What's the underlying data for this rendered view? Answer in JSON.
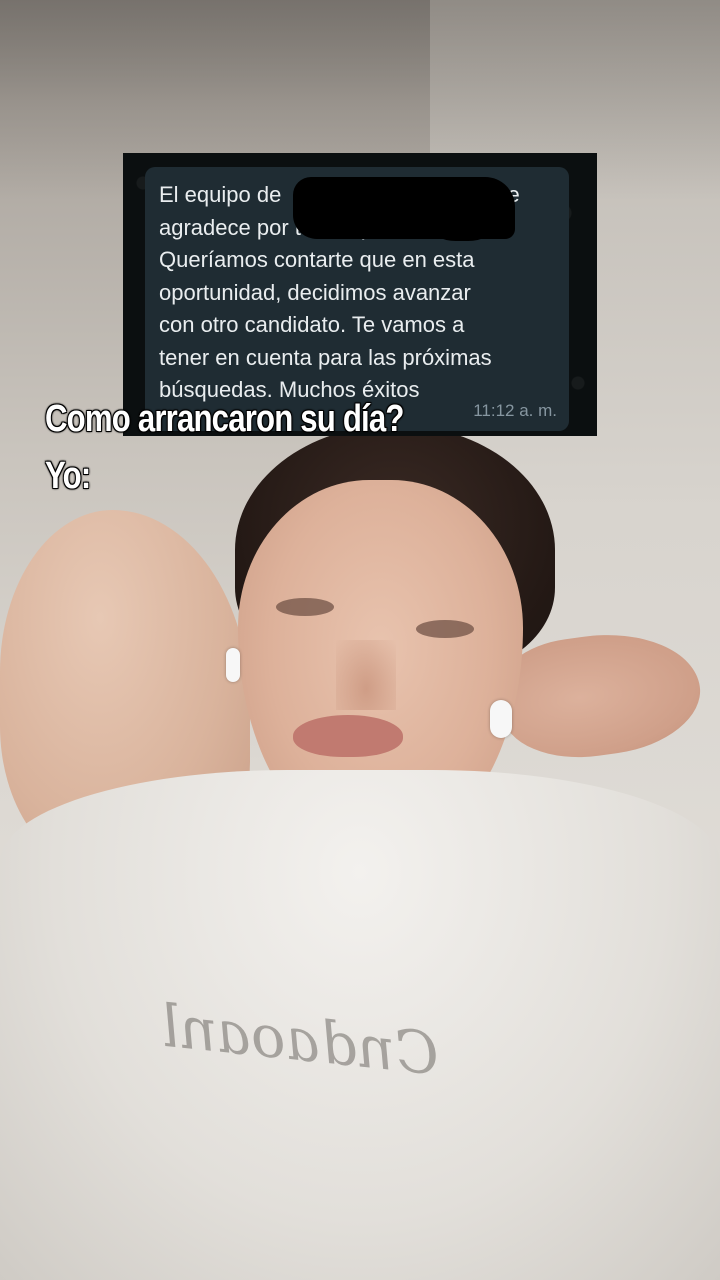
{
  "message": {
    "text": "El equipo de                                    te\nagradece por tu tiempo.\nQueríamos contarte que en esta\noportunidad, decidimos avanzar\ncon otro candidato. Te vamos a\ntener en cuenta para las próximas\nbúsquedas. Muchos éxitos",
    "time": "11:12 a. m."
  },
  "caption": {
    "question": "Como arrancaron su día?",
    "answer": "Yo:"
  },
  "shirt_print": "Cndaoanl"
}
